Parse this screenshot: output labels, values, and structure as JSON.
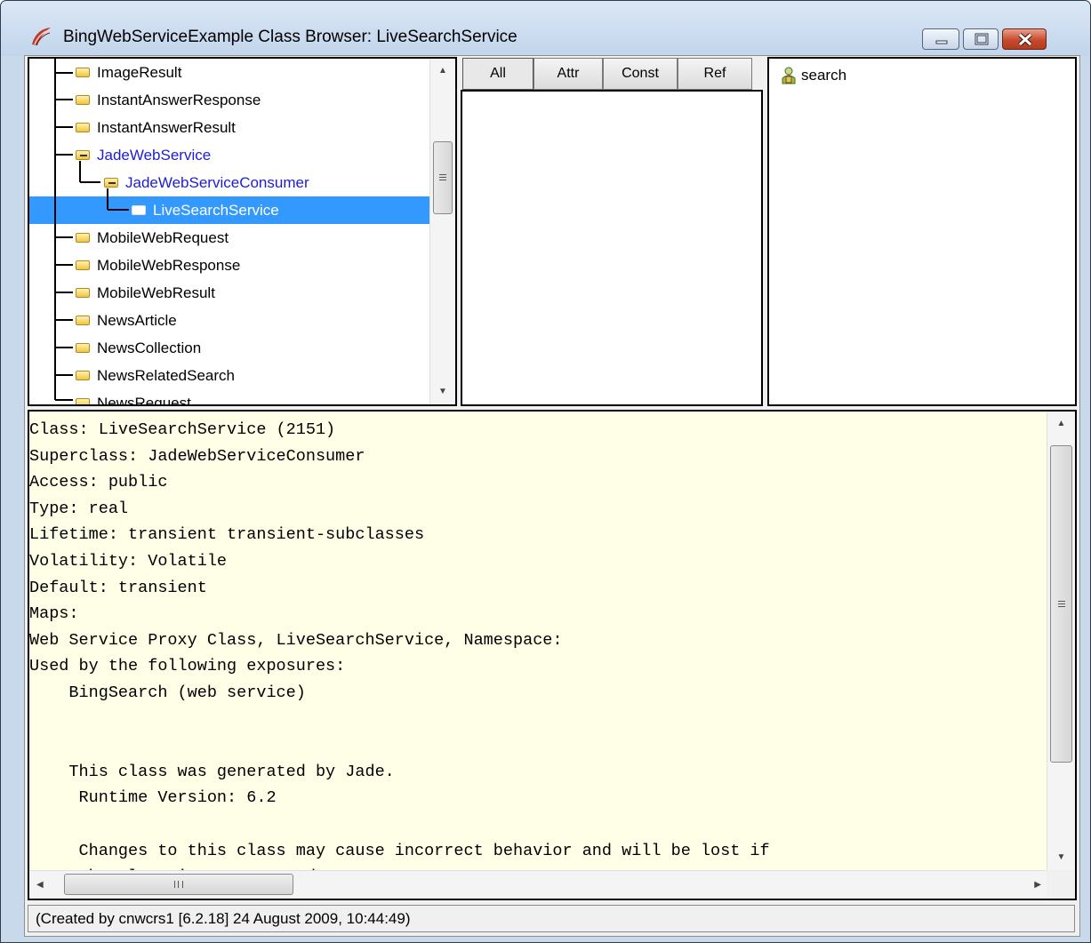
{
  "window": {
    "title": "BingWebServiceExample Class Browser: LiveSearchService",
    "icon": "jade-app-icon",
    "controls": [
      "minimize-icon",
      "maximize-icon",
      "close-icon"
    ]
  },
  "class_tree": {
    "items": [
      {
        "label": "ImageResult",
        "depth": 0
      },
      {
        "label": "InstantAnswerResponse",
        "depth": 0
      },
      {
        "label": "InstantAnswerResult",
        "depth": 0
      },
      {
        "label": "JadeWebService",
        "depth": 0,
        "expanded": true,
        "color": "#1d1dd6"
      },
      {
        "label": "JadeWebServiceConsumer",
        "depth": 1,
        "expanded": true,
        "color": "#1d1dd6"
      },
      {
        "label": "LiveSearchService",
        "depth": 2,
        "selected": true
      },
      {
        "label": "MobileWebRequest",
        "depth": 0
      },
      {
        "label": "MobileWebResponse",
        "depth": 0
      },
      {
        "label": "MobileWebResult",
        "depth": 0
      },
      {
        "label": "NewsArticle",
        "depth": 0
      },
      {
        "label": "NewsCollection",
        "depth": 0
      },
      {
        "label": "NewsRelatedSearch",
        "depth": 0
      },
      {
        "label": "NewsRequest",
        "depth": 0
      }
    ]
  },
  "property_tabs": {
    "tabs": [
      "All",
      "Attr",
      "Const",
      "Ref"
    ],
    "active": "All",
    "accelerator_colors": {
      "selection": "#3399ff"
    }
  },
  "methods": {
    "items": [
      {
        "label": "search",
        "icon": "public-method-icon"
      }
    ]
  },
  "definition": {
    "lines": [
      "Class: LiveSearchService (2151)",
      "Superclass: JadeWebServiceConsumer",
      "Access: public",
      "Type: real",
      "Lifetime: transient transient-subclasses",
      "Volatility: Volatile",
      "Default: transient",
      "Maps:",
      "Web Service Proxy Class, LiveSearchService, Namespace:",
      "Used by the following exposures:",
      "    BingSearch (web service)",
      "",
      "",
      "    This class was generated by Jade.",
      "     Runtime Version: 6.2",
      "",
      "     Changes to this class may cause incorrect behavior and will be lost if",
      "     the class is regenerated."
    ],
    "background": "#ffffe8"
  },
  "status_bar": {
    "text": "(Created by cnwcrs1 [6.2.18] 24 August 2009, 10:44:49)"
  }
}
